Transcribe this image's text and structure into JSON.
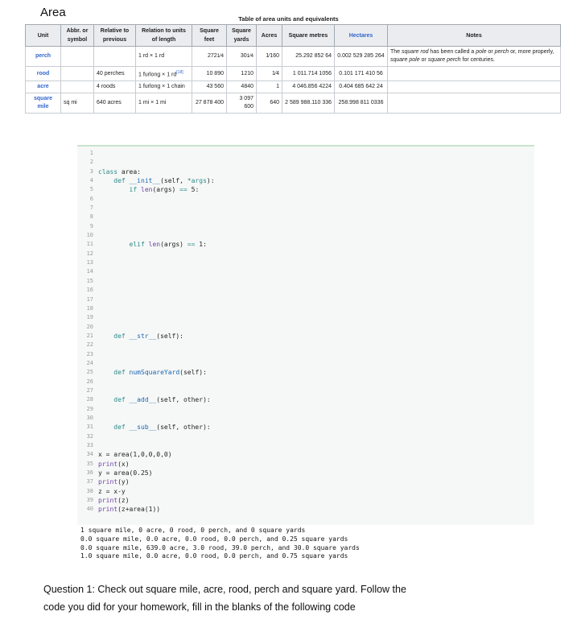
{
  "title": "Area",
  "table": {
    "caption": "Table of area units and equivalents",
    "headers": {
      "unit": "Unit",
      "abbr": [
        "Abbr. or",
        "symbol"
      ],
      "relative": [
        "Relative to",
        "previous"
      ],
      "relation": [
        "Relation to units",
        "of length"
      ],
      "sqft": [
        "Square",
        "feet"
      ],
      "sqyd": [
        "Square",
        "yards"
      ],
      "acres": "Acres",
      "sqm": "Square metres",
      "hectares": "Hectares",
      "notes": "Notes"
    },
    "rows": [
      {
        "unit": "perch",
        "abbr": "",
        "relative": "",
        "relation": "1 rd × 1 rd",
        "ref": "",
        "sqft_int": "272",
        "sqft_frac": "1⁄4",
        "sqyd_int": "30",
        "sqyd_frac": "1⁄4",
        "acres": "1⁄160",
        "sqm": "25.292 852 64",
        "ha": "0.002 529 285 264",
        "notes_parts": [
          "The ",
          "square rod",
          " has been called a ",
          "pole",
          " or ",
          "perch",
          " or, more properly, ",
          "square pole",
          " or ",
          "square perch",
          " for centuries."
        ]
      },
      {
        "unit": "rood",
        "abbr": "",
        "relative": "40 perches",
        "relation": "1 furlong × 1 rd",
        "ref": "[18]",
        "sqft_int": "10 890",
        "sqft_frac": "",
        "sqyd_int": "1210",
        "sqyd_frac": "",
        "acres": "1⁄4",
        "sqm": "1 011.714 1056",
        "ha": "0.101 171 410 56",
        "notes_parts": []
      },
      {
        "unit": "acre",
        "abbr": "",
        "relative": "4 roods",
        "relation": "1 furlong × 1 chain",
        "ref": "",
        "sqft_int": "43 560",
        "sqft_frac": "",
        "sqyd_int": "4840",
        "sqyd_frac": "",
        "acres": "1",
        "sqm": "4 046.856 4224",
        "ha": "0.404 685 642 24",
        "notes_parts": []
      },
      {
        "unit": "square mile",
        "abbr": "sq mi",
        "relative": "640 acres",
        "relation": "1 mi × 1 mi",
        "ref": "",
        "sqft_int": "27 878 400",
        "sqft_frac": "",
        "sqyd_int": "3 097 600",
        "sqyd_frac": "",
        "acres": "640",
        "sqm": "2 589 988.110 336",
        "ha": "258.998 811 0336",
        "notes_parts": []
      }
    ]
  },
  "code": {
    "line_numbers": [
      "1",
      "2",
      "3",
      "4",
      "5",
      "6",
      "7",
      "8",
      "9",
      "10",
      "11",
      "12",
      "13",
      "14",
      "15",
      "16",
      "17",
      "18",
      "19",
      "20",
      "21",
      "22",
      "23",
      "24",
      "25",
      "26",
      "27",
      "28",
      "29",
      "30",
      "31",
      "32",
      "33",
      "34",
      "35",
      "36",
      "37",
      "38",
      "39",
      "40"
    ],
    "lines": [
      "",
      "",
      "class area:",
      "    def __init__(self, *args):",
      "        if len(args) == 5:",
      "",
      "",
      "",
      "",
      "",
      "        elif len(args) == 1:",
      "",
      "",
      "",
      "",
      "",
      "",
      "",
      "",
      "",
      "    def __str__(self):",
      "",
      "",
      "",
      "    def numSquareYard(self):",
      "",
      "",
      "    def __add__(self, other):",
      "",
      "",
      "    def __sub__(self, other):",
      "",
      "",
      "x = area(1,0,0,0,0)",
      "print(x)",
      "y = area(0.25)",
      "print(y)",
      "z = x-y",
      "print(z)",
      "print(z+area(1))"
    ]
  },
  "output": [
    "1 square mile, 0 acre, 0 rood, 0 perch, and 0 square yards",
    "0.0 square mile, 0.0 acre, 0.0 rood, 0.0 perch, and 0.25 square yards",
    "0.0 square mile, 639.0 acre, 3.0 rood, 39.0 perch, and 30.0 square yards",
    "1.0 square mile, 0.0 acre, 0.0 rood, 0.0 perch, and 0.75 square yards"
  ],
  "question": "Question 1: Check out square mile, acre, rood, perch and square yard. Follow the code you did for your homework, fill in the blanks of the following code"
}
